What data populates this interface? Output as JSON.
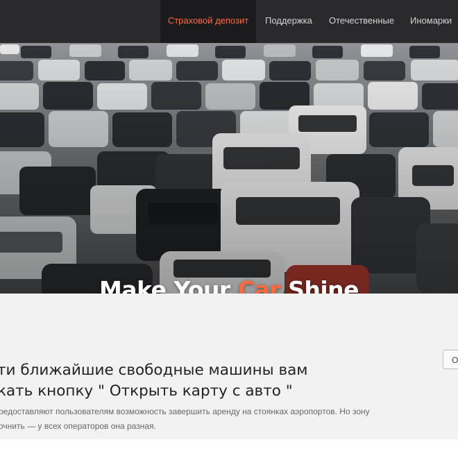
{
  "nav": {
    "items": [
      {
        "label": "Страховой депозит",
        "active": true
      },
      {
        "label": "Поддержка",
        "active": false
      },
      {
        "label": "Отечественные",
        "active": false
      },
      {
        "label": "Иномарки",
        "active": false
      }
    ],
    "accent_color": "#ff6a3d",
    "background_color": "#2a2a2d"
  },
  "hero": {
    "title_part1": "Make Your ",
    "title_accent": "Car",
    "title_part2": " Shine"
  },
  "content": {
    "heading_line1": "ти ближайшие свободные машины вам",
    "heading_line2": "кать кнопку \" Открыть карту с авто \"",
    "text_line1": "редоставляют пользователям возможность завершить аренду на стоянках аэропортов. Но зону",
    "text_line2": "очнить — у всех операторов она разная.",
    "button_label": "О"
  }
}
